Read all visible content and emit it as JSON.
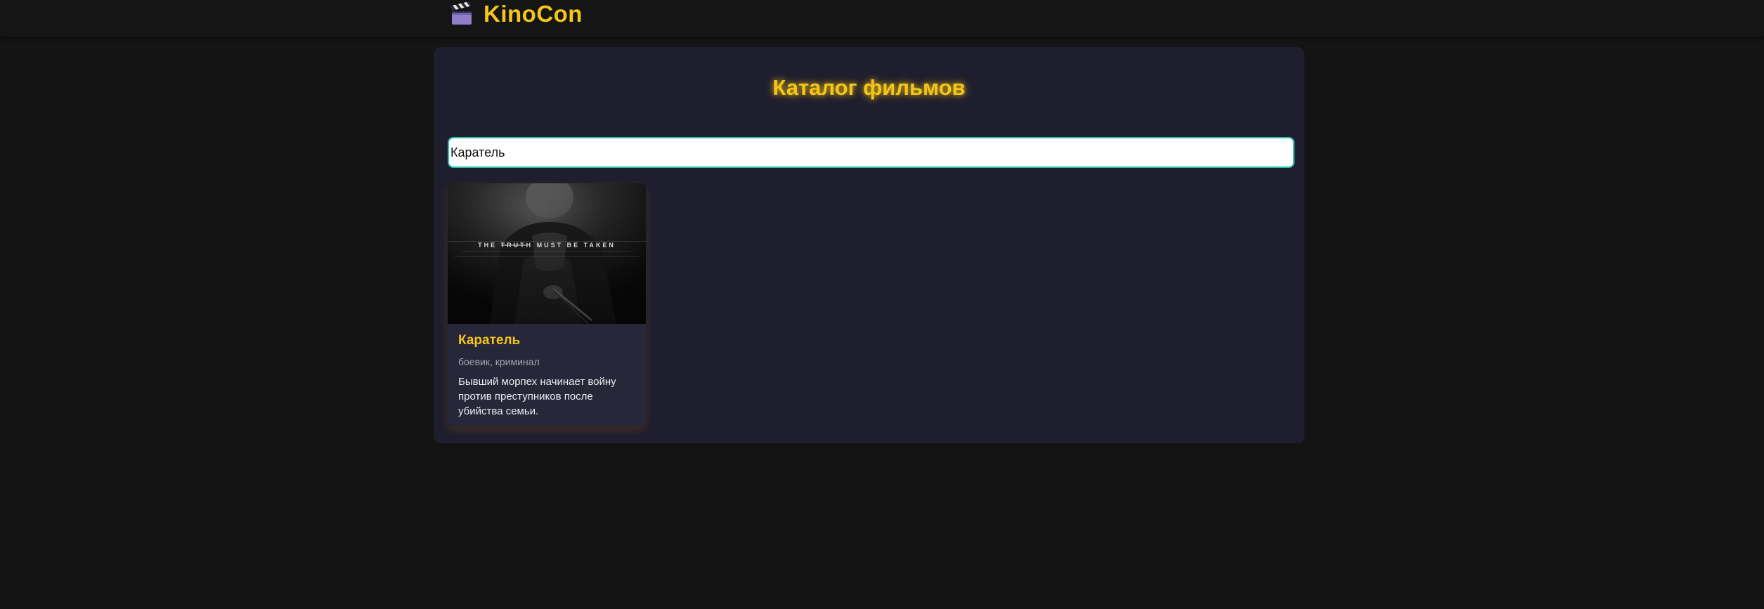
{
  "header": {
    "brand_icon": "clapperboard-icon",
    "brand_name": "KinoCon"
  },
  "catalog": {
    "title": "Каталог фильмов",
    "search_value": "Каратель"
  },
  "movies": [
    {
      "title": "Каратель",
      "genres": "боевик, криминал",
      "description": "Бывший морпех начинает войну против преступников после убийства семьи.",
      "poster_tagline_struck": "TRUTH",
      "poster_tagline": "THE TRUTH MUST BE TAKEN"
    }
  ],
  "colors": {
    "accent": "#f5c518",
    "background": "#141414",
    "panel": "#1f1e2e",
    "card": "#272739",
    "search_border": "#2bbfa6"
  }
}
